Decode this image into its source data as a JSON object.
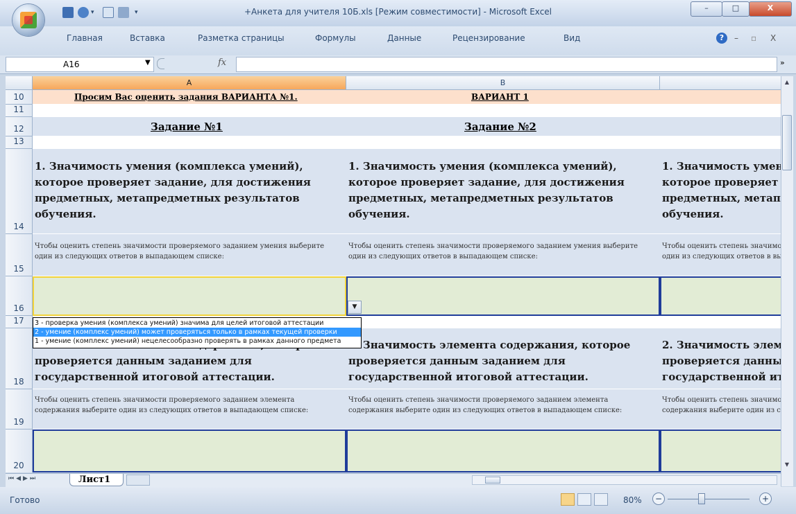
{
  "window": {
    "title": "+Анкета для учителя 10Б.xls  [Режим совместимости] - Microsoft Excel",
    "minimize": "–",
    "maximize": "□",
    "close": "X"
  },
  "ribbon": {
    "tabs": [
      "Главная",
      "Вставка",
      "Разметка страницы",
      "Формулы",
      "Данные",
      "Рецензирование",
      "Вид"
    ],
    "help": "?",
    "min": "–",
    "restore": "▫",
    "close": "X"
  },
  "formula_bar": {
    "name_box": "A16",
    "fx": "fx",
    "value": ""
  },
  "columns": [
    "A",
    "B"
  ],
  "rows": {
    "r10": {
      "num": "10",
      "a": "Просим Вас оценить задания ВАРИАНТА №1.",
      "b": "ВАРИАНТ 1"
    },
    "r11": {
      "num": "11"
    },
    "r12": {
      "num": "12",
      "a": "Задание №1",
      "b": "Задание №2"
    },
    "r13": {
      "num": "13"
    },
    "r14": {
      "num": "14",
      "text": "1. Значимость умения (комплекса умений), которое проверяет задание, для достижения предметных, метапредметных результатов обучения."
    },
    "r15": {
      "num": "15",
      "text": "Чтобы оценить степень значимости проверяемого заданием умения выберите один из следующих ответов в выпадающем списке:"
    },
    "r16": {
      "num": "16"
    },
    "r17": {
      "num": "17"
    },
    "r18": {
      "num": "18",
      "text": "2. Значимость элемента содержания, которое проверяется данным заданием для государственной итоговой аттестации."
    },
    "r19": {
      "num": "19",
      "text": "Чтобы оценить степень значимости проверяемого заданием элемента содержания выберите один из следующих ответов в выпадающем списке:"
    },
    "r20": {
      "num": "20"
    }
  },
  "dropdown": {
    "options": [
      "3 - проверка умения (комплекса умений) значима для целей итоговой аттестации",
      "2 - умение (комплекс умений) может проверяться только в рамках текущей проверки",
      "1 - умение (комплекс умений) нецелесообразно проверять в рамках данного предмета"
    ],
    "selected_index": 1
  },
  "sheet_tabs": {
    "active": "Лист1"
  },
  "status": {
    "ready": "Готово",
    "zoom": "80%",
    "zoom_out": "−",
    "zoom_in": "+"
  },
  "colors": {
    "header_band": "#fde0cc",
    "task_band": "#dae3f0",
    "input_fill": "#e2ecd5",
    "input_border": "#1f3c9a",
    "selected_option": "#3399ff"
  }
}
